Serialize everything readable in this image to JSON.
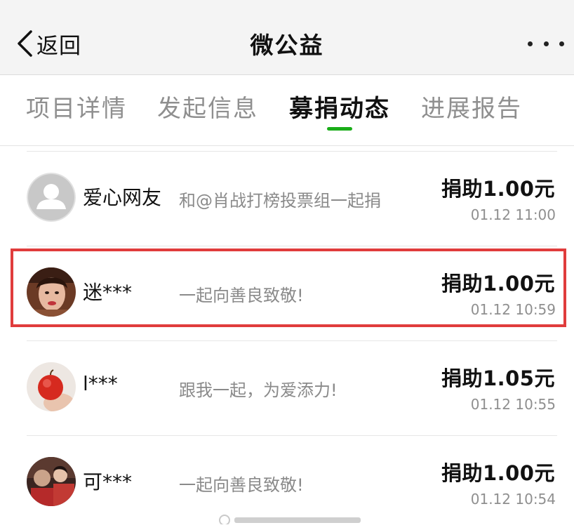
{
  "nav": {
    "back_label": "返回",
    "title": "微公益"
  },
  "tabs": [
    {
      "label": "项目详情",
      "active": false
    },
    {
      "label": "发起信息",
      "active": false
    },
    {
      "label": "募捐动态",
      "active": true
    },
    {
      "label": "进展报告",
      "active": false
    }
  ],
  "colors": {
    "accent": "#1aad19",
    "highlight": "#e03c3c"
  },
  "donations": [
    {
      "name": "爱心网友",
      "message": "和@肖战打榜投票组一起捐",
      "amount": "捐助1.00元",
      "time": "01.12 11:00",
      "avatar": "default-avatar-icon"
    },
    {
      "name": "迷***",
      "message": "一起向善良致敬!",
      "amount": "捐助1.00元",
      "time": "01.12 10:59",
      "avatar": "user-photo"
    },
    {
      "name": "l***",
      "message": "跟我一起，为爱添力!",
      "amount": "捐助1.05元",
      "time": "01.12 10:55",
      "avatar": "apple-photo"
    },
    {
      "name": "可***",
      "message": "一起向善良致敬!",
      "amount": "捐助1.00元",
      "time": "01.12 10:54",
      "avatar": "group-photo"
    }
  ]
}
